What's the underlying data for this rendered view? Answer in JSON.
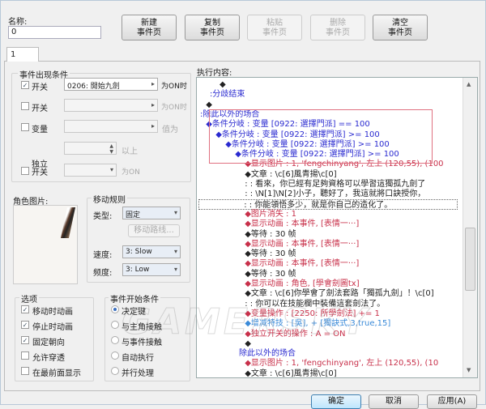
{
  "name": {
    "label": "名称:",
    "value": "0"
  },
  "toolbar": [
    {
      "label1": "新建",
      "label2": "事件页",
      "enabled": true
    },
    {
      "label1": "复制",
      "label2": "事件页",
      "enabled": true
    },
    {
      "label1": "粘贴",
      "label2": "事件页",
      "enabled": false
    },
    {
      "label1": "删除",
      "label2": "事件页",
      "enabled": false
    },
    {
      "label1": "清空",
      "label2": "事件页",
      "enabled": true
    }
  ],
  "tabs": [
    "1"
  ],
  "conditions": {
    "title": "事件出现条件",
    "switch1": {
      "label": "开关",
      "checked": true,
      "value": "0206: 開始九劍",
      "suffix": "为ON时"
    },
    "switch2": {
      "label": "开关",
      "checked": false,
      "value": "",
      "suffix": "为ON时"
    },
    "variable": {
      "label": "变量",
      "checked": false,
      "value": "",
      "suffix": "值为",
      "suffix2": "以上"
    },
    "self_switch": {
      "label": "独立开关",
      "checked": false,
      "value": "",
      "suffix": "为ON"
    }
  },
  "graphic": {
    "label": "角色图片:"
  },
  "movement": {
    "title": "移动规则",
    "type_label": "类型:",
    "type": "固定",
    "route_button": "移动路线...",
    "speed_label": "速度:",
    "speed": "3: Slow",
    "freq_label": "频度:",
    "freq": "3: Low"
  },
  "options": {
    "title": "选项",
    "items": [
      {
        "label": "移动时动画",
        "checked": true
      },
      {
        "label": "停止时动画",
        "checked": true
      },
      {
        "label": "固定朝向",
        "checked": true
      },
      {
        "label": "允许穿透",
        "checked": false
      },
      {
        "label": "在最前面显示",
        "checked": false
      }
    ]
  },
  "trigger": {
    "title": "事件开始条件",
    "items": [
      {
        "label": "决定键",
        "selected": true
      },
      {
        "label": "与主角接触",
        "selected": false
      },
      {
        "label": "与事件接触",
        "selected": false
      },
      {
        "label": "自动执行",
        "selected": false
      },
      {
        "label": "并行处理",
        "selected": false
      }
    ]
  },
  "commands": {
    "label": "执行内容:",
    "lines": [
      {
        "depth": 2,
        "text": "◆",
        "color": "black"
      },
      {
        "depth": 1,
        "text": ":分歧结束",
        "color": "blue"
      },
      {
        "depth": 0.6,
        "text": "◆",
        "color": "black"
      },
      {
        "depth": 0,
        "text": ":除此以外的场合",
        "color": "blue"
      },
      {
        "depth": 0.6,
        "text": "◆条件分岐 : 变量 [0922: 選擇門派] == 100",
        "color": "blue"
      },
      {
        "depth": 1.6,
        "text": "◆条件分岐 : 变量 [0922: 選擇門派] >= 100",
        "color": "blue"
      },
      {
        "depth": 2.6,
        "text": "◆条件分岐 : 变量 [0922: 選擇門派] >= 100",
        "color": "blue"
      },
      {
        "depth": 3.6,
        "text": "◆条件分岐 : 变量 [0922: 選擇門派] >= 100",
        "color": "blue"
      },
      {
        "depth": 4.6,
        "text": "◆显示图片 : 1, 'fengchinyang', 左上 (120,55), (100",
        "color": "red"
      },
      {
        "depth": 4.6,
        "text": "◆文章 : \\c[6]風青揚\\c[0]",
        "color": "black"
      },
      {
        "depth": 4.6,
        "text": " :      : 看來，你已經有足夠資格可以學習這獨孤九劍了",
        "color": "black"
      },
      {
        "depth": 4.6,
        "text": " :      : \\N[1]\\N[2]小子，聽好了，我這就將口訣授你，",
        "color": "black"
      },
      {
        "depth": 4.6,
        "text": " :      : 你能領悟多少，就是你自己的造化了。",
        "color": "black",
        "selected": true
      },
      {
        "depth": 4.6,
        "text": "◆图片消失 : 1",
        "color": "red"
      },
      {
        "depth": 4.6,
        "text": "◆显示动画 : 本事件, [表情一···]",
        "color": "red"
      },
      {
        "depth": 4.6,
        "text": "◆等待 : 30 帧",
        "color": "black"
      },
      {
        "depth": 4.6,
        "text": "◆显示动画 : 本事件, [表情一···]",
        "color": "red"
      },
      {
        "depth": 4.6,
        "text": "◆等待 : 30 帧",
        "color": "black"
      },
      {
        "depth": 4.6,
        "text": "◆显示动画 : 本事件, [表情一···]",
        "color": "red"
      },
      {
        "depth": 4.6,
        "text": "◆等待 : 30 帧",
        "color": "black"
      },
      {
        "depth": 4.6,
        "text": "◆显示动画 : 角色, [學會劍圖tx]",
        "color": "red"
      },
      {
        "depth": 4.6,
        "text": "◆文章 : \\c[6]你學會了劍法套路「獨孤九劍」！\\c[0]",
        "color": "black"
      },
      {
        "depth": 4.6,
        "text": " :      : 你可以在技能欄中裝備這套劍法了。",
        "color": "black"
      },
      {
        "depth": 4.6,
        "text": "◆变量操作 : [2250: 所學劍法] += 1",
        "color": "red"
      },
      {
        "depth": 4.6,
        "text": "◆增减特技 : [吳], + [獨訣式,3,true,15]",
        "color": "lblue"
      },
      {
        "depth": 4.6,
        "text": "◆独立开关的操作 : A = ON",
        "color": "red"
      },
      {
        "depth": 4.6,
        "text": "◆",
        "color": "black"
      },
      {
        "depth": 4,
        "text": "除此以外的场合",
        "color": "blue"
      },
      {
        "depth": 4.6,
        "text": "◆显示图片 : 1, 'fengchinyang', 左上 (120,55), (10",
        "color": "red"
      },
      {
        "depth": 4.6,
        "text": "◆文章 : \\c[6]風青揚\\c[0]",
        "color": "black"
      }
    ]
  },
  "footer": {
    "ok": "确定",
    "cancel": "取消",
    "apply": "应用(A)"
  },
  "watermark": "GAMERSKY"
}
